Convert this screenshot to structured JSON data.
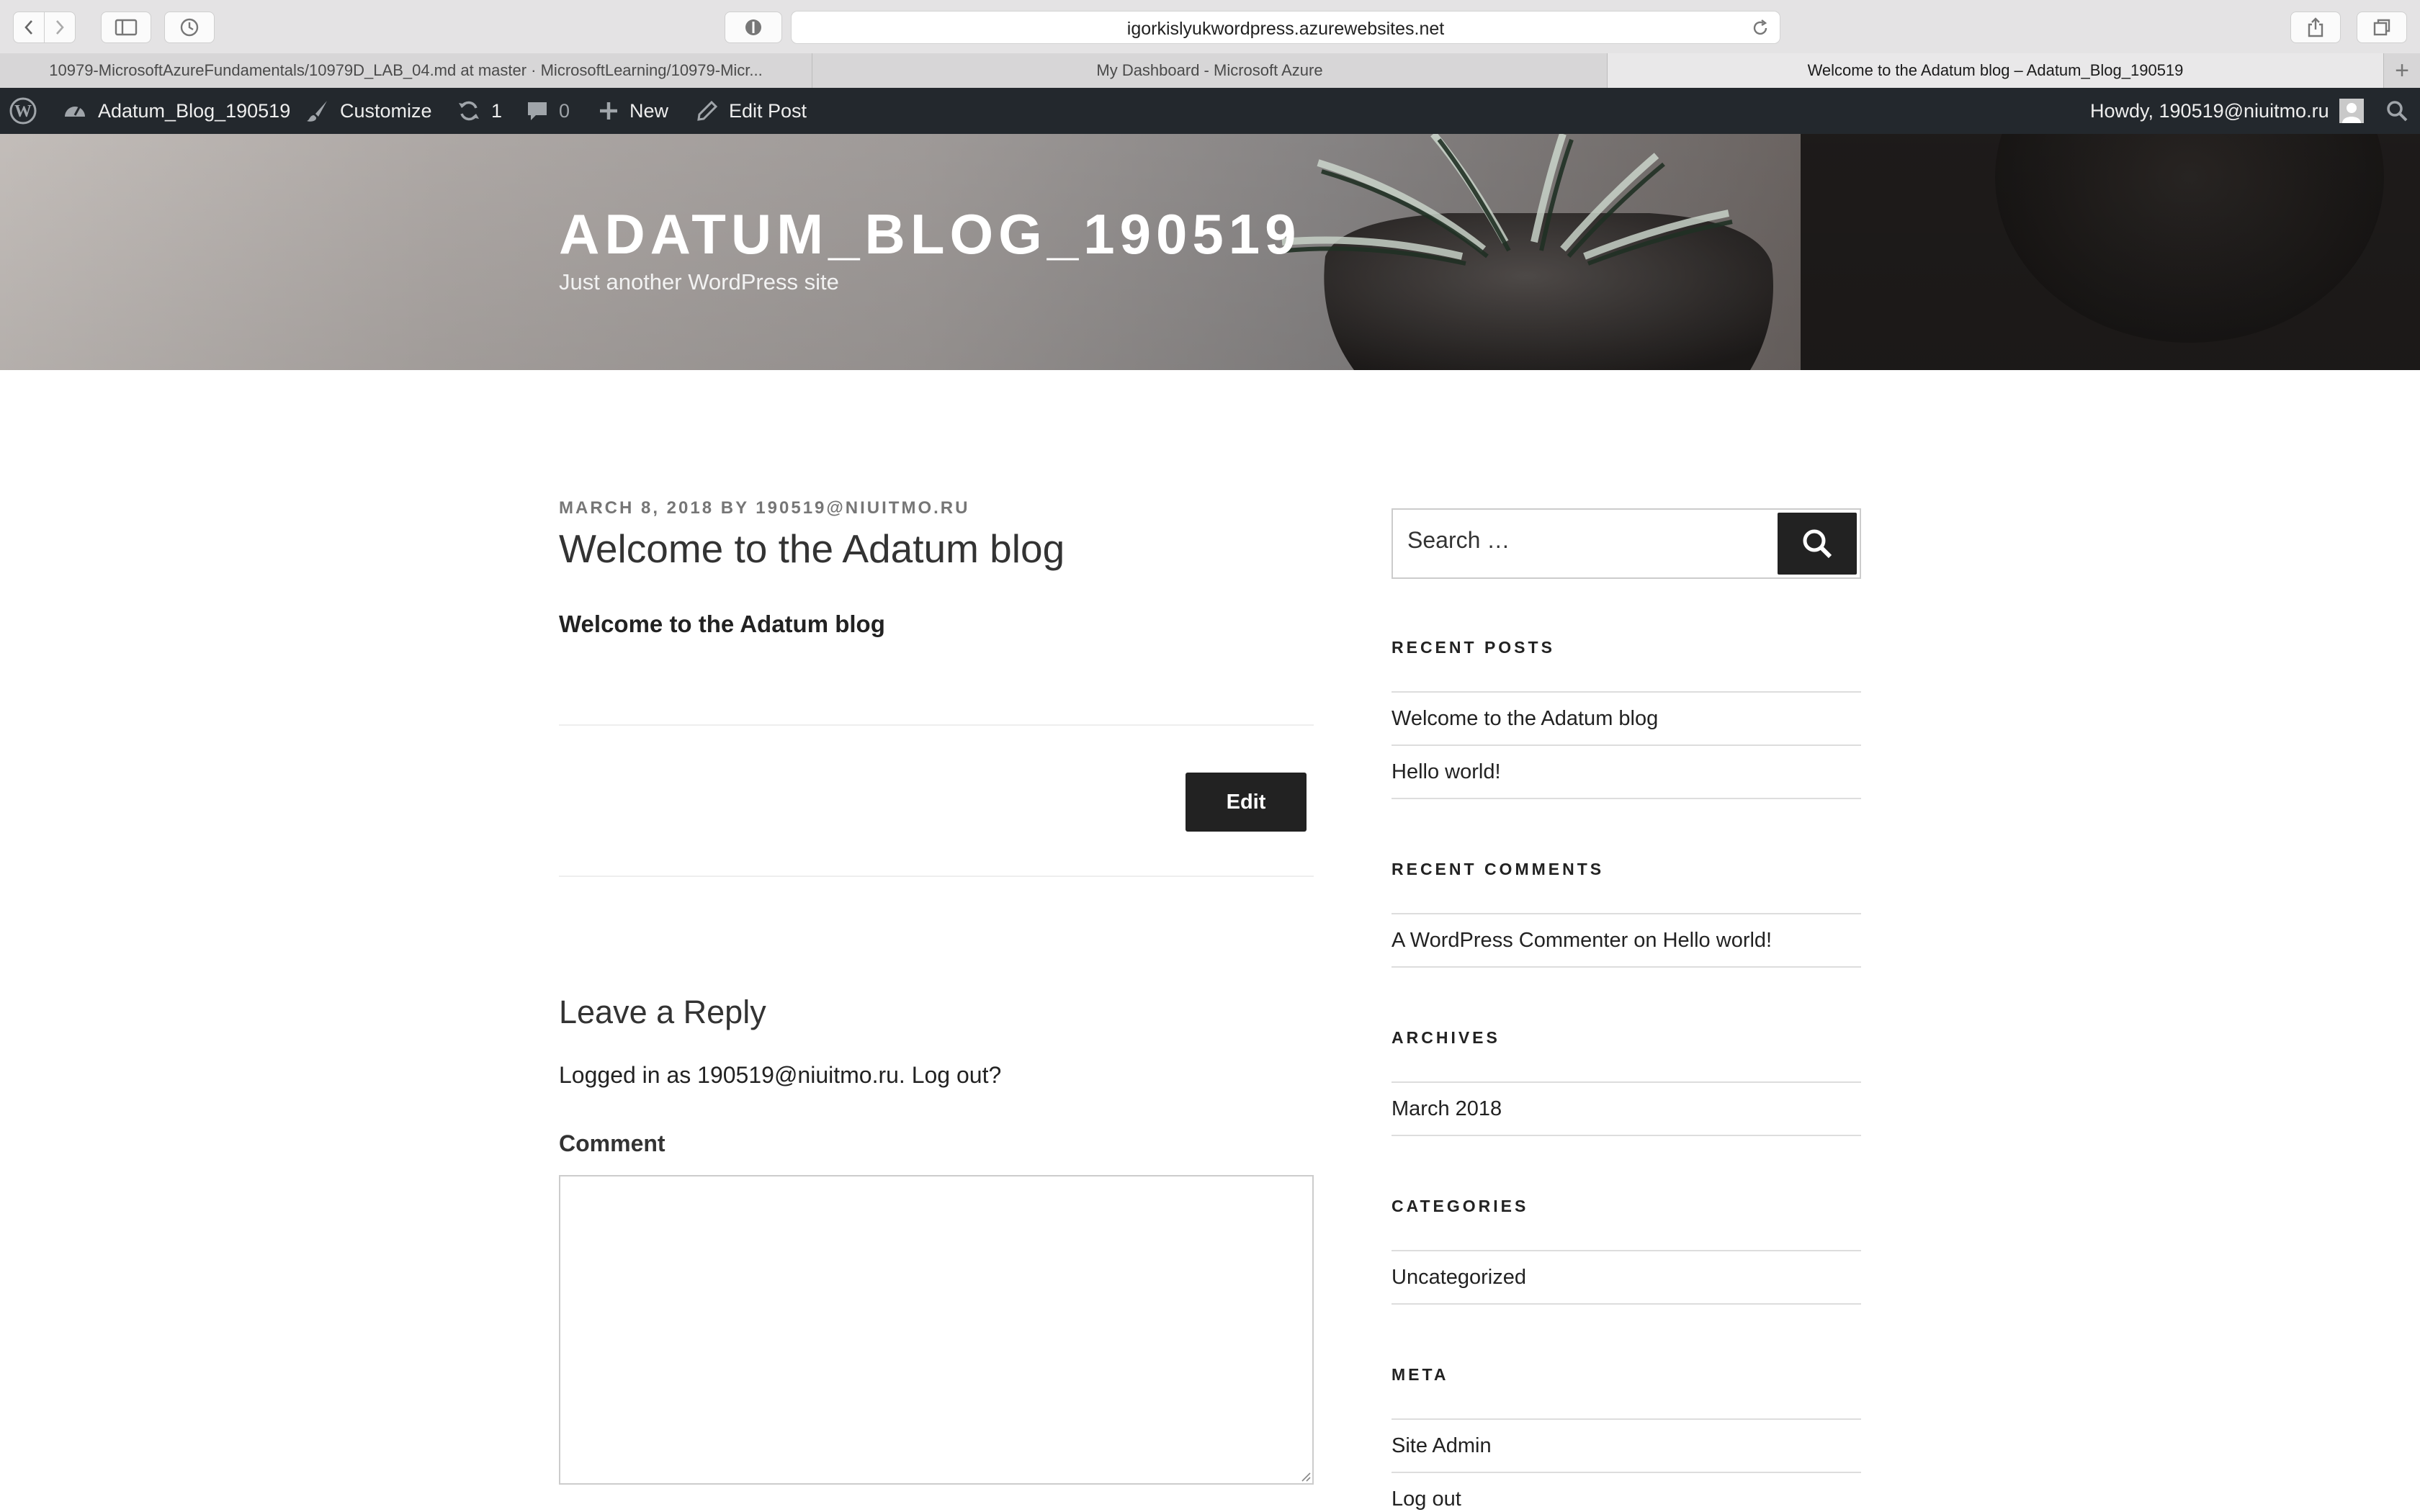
{
  "browser": {
    "url": "igorkislyukwordpress.azurewebsites.net",
    "tabs": [
      {
        "label": "10979-MicrosoftAzureFundamentals/10979D_LAB_04.md at master · MicrosoftLearning/10979-Micr..."
      },
      {
        "label": "My Dashboard - Microsoft Azure"
      },
      {
        "label": "Welcome to the Adatum blog – Adatum_Blog_190519"
      }
    ],
    "new_tab_glyph": "+"
  },
  "adminbar": {
    "site_name": "Adatum_Blog_190519",
    "customize": "Customize",
    "updates_count": "1",
    "comments_count": "0",
    "new": "New",
    "edit_post": "Edit Post",
    "howdy": "Howdy, 190519@niuitmo.ru"
  },
  "header": {
    "site_title": "ADATUM_BLOG_190519",
    "site_description": "Just another WordPress site"
  },
  "post": {
    "meta": "MARCH 8, 2018 BY 190519@NIUITMO.RU",
    "title": "Welcome to the Adatum blog",
    "content": "Welcome to the Adatum blog",
    "edit_label": "Edit"
  },
  "reply": {
    "title": "Leave a Reply",
    "logged_in": "Logged in as 190519@niuitmo.ru. Log out?",
    "comment_label": "Comment"
  },
  "sidebar": {
    "search_placeholder": "Search …",
    "recent_posts_title": "RECENT POSTS",
    "recent_posts": [
      "Welcome to the Adatum blog",
      "Hello world!"
    ],
    "recent_comments_title": "RECENT COMMENTS",
    "recent_comments": [
      "A WordPress Commenter on Hello world!"
    ],
    "archives_title": "ARCHIVES",
    "archives": [
      "March 2018"
    ],
    "categories_title": "CATEGORIES",
    "categories": [
      "Uncategorized"
    ],
    "meta_title": "META",
    "meta": [
      "Site Admin",
      "Log out"
    ]
  },
  "colors": {
    "adminbar_bg": "#23282d",
    "button_dark": "#222222"
  }
}
